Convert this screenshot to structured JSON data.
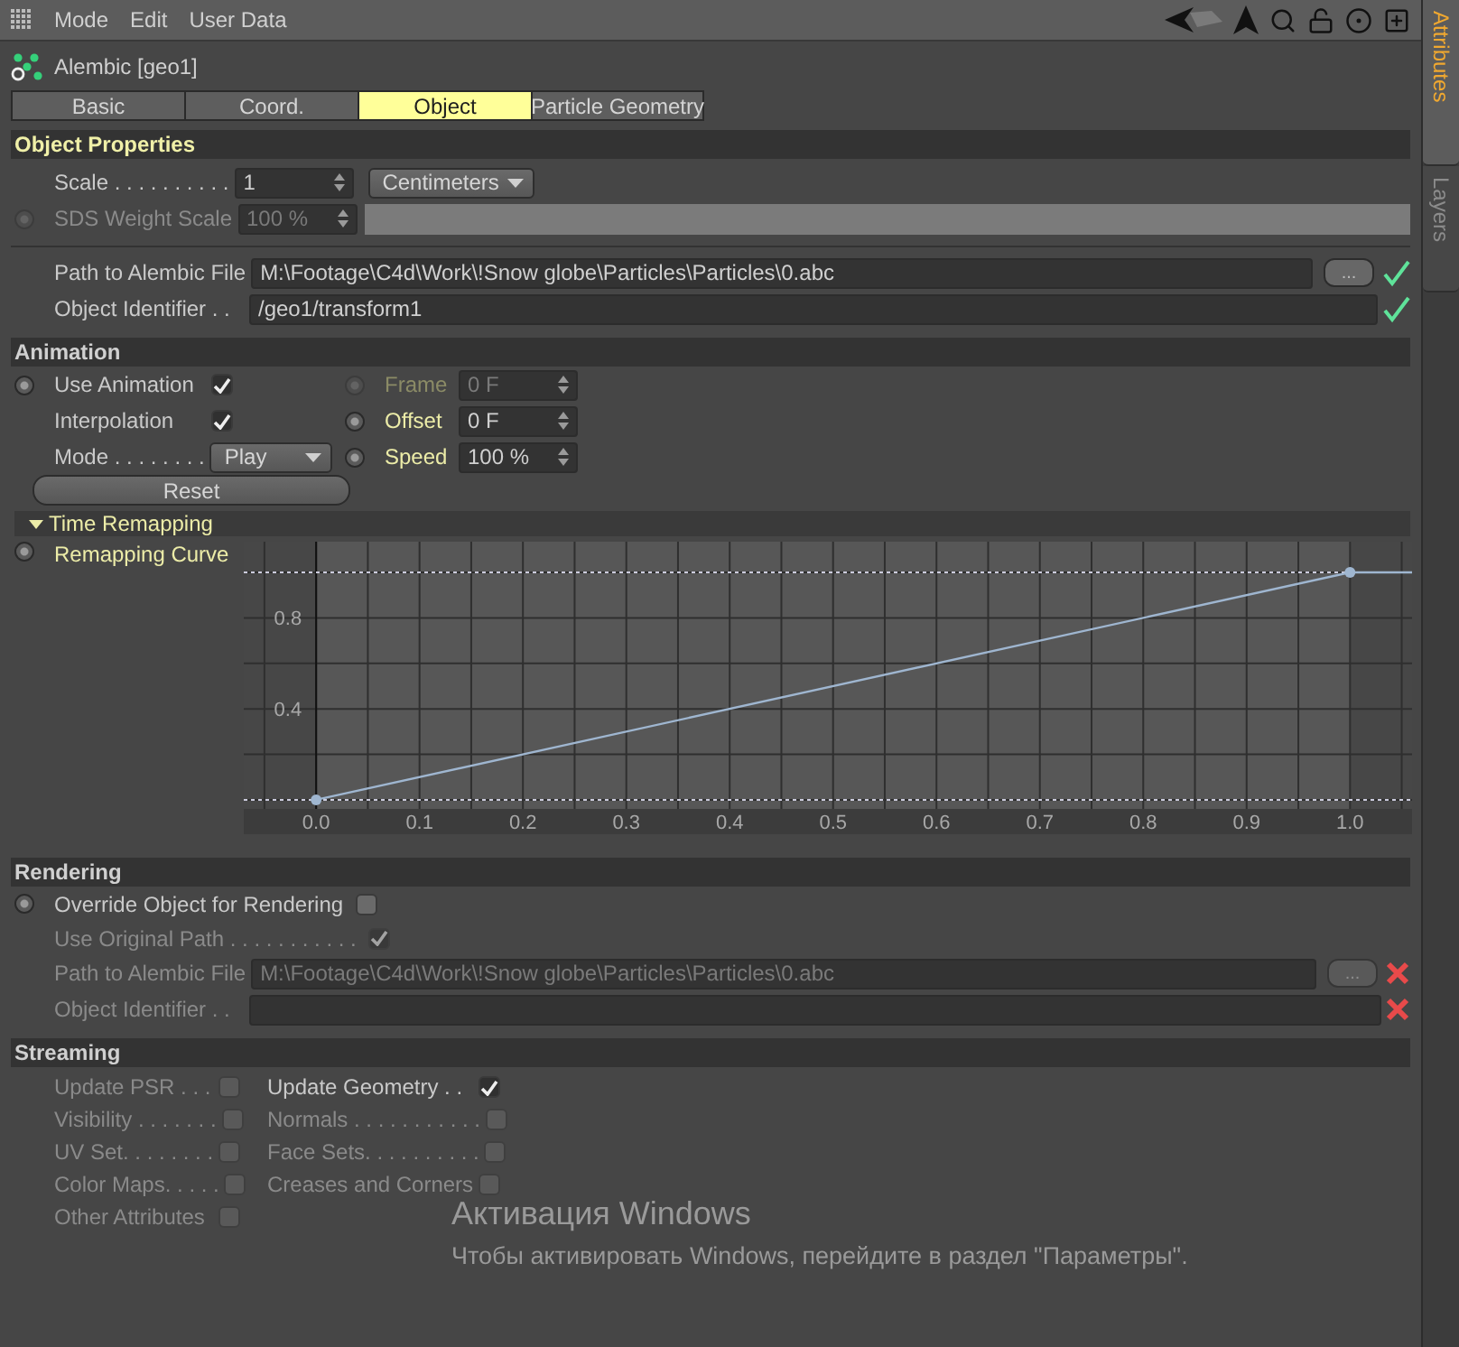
{
  "menu": [
    {
      "label": "Mode"
    },
    {
      "label": "Edit"
    },
    {
      "label": "User Data"
    }
  ],
  "side_tabs": [
    {
      "label": "Attributes",
      "selected": true
    },
    {
      "label": "Layers",
      "selected": false
    }
  ],
  "object": {
    "title": "Alembic [geo1]"
  },
  "tabs": [
    {
      "label": "Basic",
      "selected": false
    },
    {
      "label": "Coord.",
      "selected": false
    },
    {
      "label": "Object",
      "selected": true
    },
    {
      "label": "Particle Geometry",
      "selected": false
    }
  ],
  "object_properties": {
    "title": "Object Properties",
    "highlighted": true,
    "scale": {
      "label": "Scale . . . . . . . . . .",
      "value": "1",
      "unit": "Centimeters"
    },
    "sds_weight_scale": {
      "label": "SDS Weight Scale",
      "value": "100 %",
      "disabled": true,
      "level": 1
    },
    "files": [
      {
        "label": "Path to Alembic File",
        "value": "M:\\Footage\\C4d\\Work\\!Snow globe\\Particles\\Particles\\0.abc",
        "browse": "...",
        "valid": true
      },
      {
        "label": "Object Identifier . .",
        "value": "/geo1/transform1",
        "valid": true
      }
    ]
  },
  "animation": {
    "title": "Animation",
    "highlighted": false,
    "left": [
      {
        "kind": "checkbox",
        "label": "Use Animation",
        "checked": true,
        "keyable": true
      },
      {
        "kind": "checkbox",
        "label": "Interpolation",
        "checked": true,
        "keyable": false
      },
      {
        "kind": "dropdown",
        "label": "Mode . . . . . . . .",
        "value": "Play",
        "keyable": false
      }
    ],
    "reset": "Reset",
    "right": [
      {
        "label": "Frame",
        "value": "0 F",
        "disabled": true,
        "highlighted": true
      },
      {
        "label": "Offset",
        "value": "0 F",
        "disabled": false,
        "highlighted": true
      },
      {
        "label": "Speed",
        "value": "100 %",
        "disabled": false,
        "highlighted": true
      }
    ],
    "time_remapping": {
      "title": "Time Remapping",
      "expanded": true,
      "chart_data": {
        "type": "line",
        "x": [
          0,
          1,
          1.06
        ],
        "xlim": [
          -0.07,
          1.06
        ],
        "ylim": [
          -0.04,
          1.135
        ],
        "grid": true,
        "series": [
          {
            "name": "Remapping Curve",
            "color": "#9fb6d0",
            "values": [
              0,
              1,
              1
            ],
            "marker": "circle"
          }
        ],
        "ref_lines": [
          {
            "axis": "y",
            "value": 0,
            "color": "#ccccdd"
          },
          {
            "axis": "y",
            "value": 1,
            "color": "#ccccdd"
          }
        ],
        "xticks": [
          {
            "value": 0,
            "label": "0.0"
          },
          {
            "value": 0.1,
            "label": "0.1"
          },
          {
            "value": 0.2,
            "label": "0.2"
          },
          {
            "value": 0.3,
            "label": "0.3"
          },
          {
            "value": 0.4,
            "label": "0.4"
          },
          {
            "value": 0.5,
            "label": "0.5"
          },
          {
            "value": 0.6,
            "label": "0.6"
          },
          {
            "value": 0.7,
            "label": "0.7"
          },
          {
            "value": 0.8,
            "label": "0.8"
          },
          {
            "value": 0.9,
            "label": "0.9"
          },
          {
            "value": 1,
            "label": "1.0"
          }
        ],
        "yticks": [
          0.4,
          0.8
        ]
      }
    }
  },
  "rendering": {
    "title": "Rendering",
    "highlighted": false,
    "rows": [
      {
        "kind": "checkbox",
        "label": "Override Object for Rendering",
        "checked": false,
        "disabled": false,
        "keyable": true
      },
      {
        "kind": "checkbox",
        "label": "Use Original Path . . . . . . . . . . .",
        "checked": true,
        "disabled": true,
        "keyable": false
      },
      {
        "kind": "file",
        "label": "Path to Alembic File",
        "value": "M:\\Footage\\C4d\\Work\\!Snow globe\\Particles\\Particles\\0.abc",
        "browse": "...",
        "valid": false,
        "disabled": true
      },
      {
        "kind": "file",
        "label": "Object Identifier . .",
        "valid": false,
        "disabled": true
      }
    ]
  },
  "streaming": {
    "title": "Streaming",
    "highlighted": false,
    "left": [
      {
        "label": "Update PSR . . .",
        "checked": false,
        "disabled": true
      },
      {
        "label": "Visibility . . . . . . .",
        "checked": false,
        "disabled": true
      },
      {
        "label": "UV Set. . . . . . . .",
        "checked": false,
        "disabled": true
      },
      {
        "label": "Color Maps. . . . .",
        "checked": false,
        "disabled": true
      },
      {
        "label": "Other Attributes",
        "checked": false,
        "disabled": true
      }
    ],
    "right": [
      {
        "label": "Update Geometry . .",
        "checked": true,
        "disabled": false
      },
      {
        "label": "Normals . . . . . . . . . . .",
        "checked": false,
        "disabled": true
      },
      {
        "label": "Face Sets. . . . . . . . . .",
        "checked": false,
        "disabled": true
      },
      {
        "label": "Creases and Corners",
        "checked": false,
        "disabled": true
      }
    ]
  },
  "watermark": {
    "title": "Активация Windows",
    "text": "Чтобы активировать Windows, перейдите в раздел \"Параметры\"."
  }
}
